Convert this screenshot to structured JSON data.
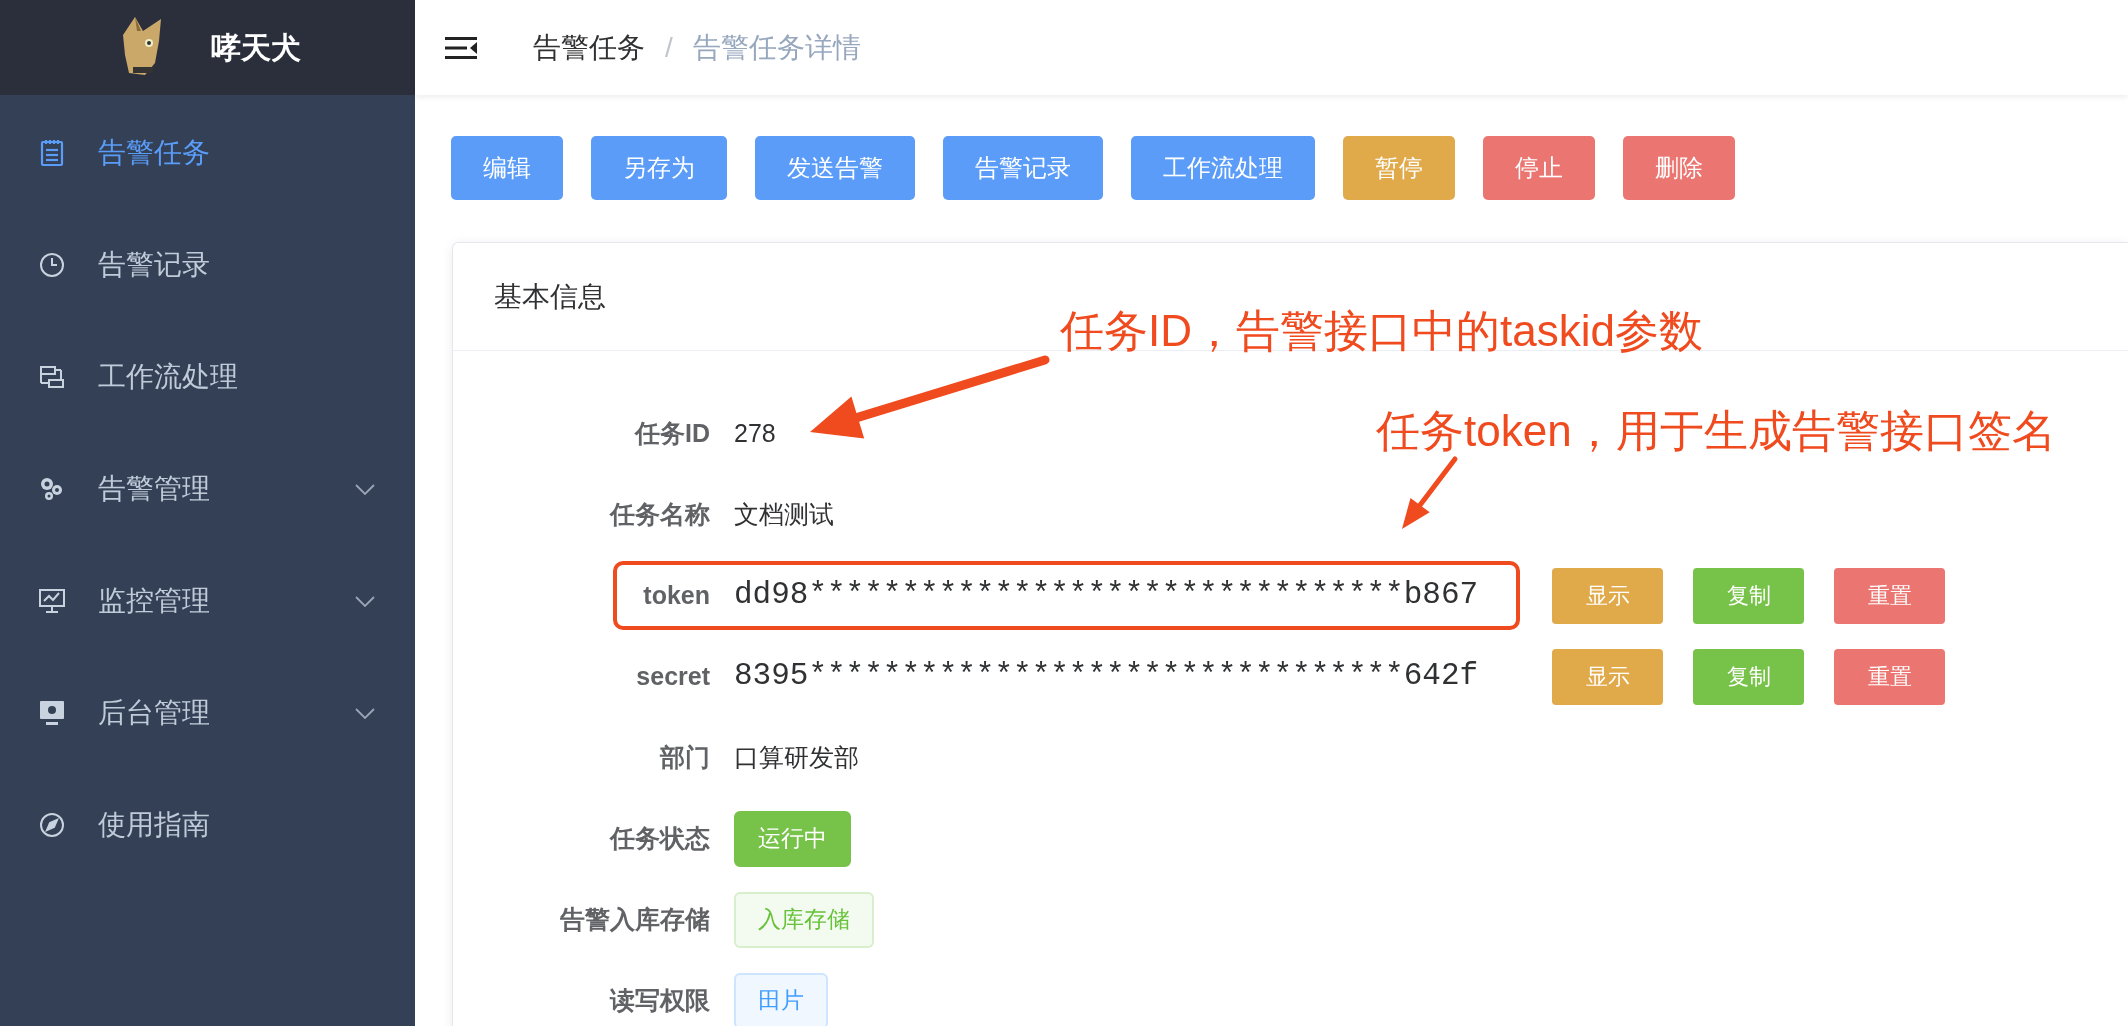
{
  "app": {
    "name": "哮天犬"
  },
  "sidebar": {
    "items": [
      {
        "label": "告警任务",
        "selected": true,
        "expandable": false
      },
      {
        "label": "告警记录",
        "selected": false,
        "expandable": false
      },
      {
        "label": "工作流处理",
        "selected": false,
        "expandable": false
      },
      {
        "label": "告警管理",
        "selected": false,
        "expandable": true
      },
      {
        "label": "监控管理",
        "selected": false,
        "expandable": true
      },
      {
        "label": "后台管理",
        "selected": false,
        "expandable": true
      },
      {
        "label": "使用指南",
        "selected": false,
        "expandable": false
      }
    ]
  },
  "breadcrumb": [
    {
      "label": "告警任务",
      "current": false
    },
    {
      "label": "告警任务详情",
      "current": true
    }
  ],
  "breadcrumb_separator": "/",
  "actions": [
    {
      "label": "编辑",
      "kind": "primary"
    },
    {
      "label": "另存为",
      "kind": "primary"
    },
    {
      "label": "发送告警",
      "kind": "primary"
    },
    {
      "label": "告警记录",
      "kind": "primary"
    },
    {
      "label": "工作流处理",
      "kind": "primary"
    },
    {
      "label": "暂停",
      "kind": "warning"
    },
    {
      "label": "停止",
      "kind": "danger"
    },
    {
      "label": "删除",
      "kind": "danger"
    }
  ],
  "card": {
    "title": "基本信息",
    "fields": [
      {
        "label": "任务ID",
        "kind": "text",
        "value": "278"
      },
      {
        "label": "任务名称",
        "kind": "text",
        "value": "文档测试"
      },
      {
        "label": "token",
        "kind": "secret",
        "value": "dd98********************************b867",
        "highlighted": true,
        "buttons": [
          {
            "label": "显示",
            "kind": "warning"
          },
          {
            "label": "复制",
            "kind": "success"
          },
          {
            "label": "重置",
            "kind": "danger"
          }
        ]
      },
      {
        "label": "secret",
        "kind": "secret",
        "value": "8395********************************642f",
        "highlighted": false,
        "buttons": [
          {
            "label": "显示",
            "kind": "warning"
          },
          {
            "label": "复制",
            "kind": "success"
          },
          {
            "label": "重置",
            "kind": "danger"
          }
        ]
      },
      {
        "label": "部门",
        "kind": "text",
        "value": "口算研发部"
      },
      {
        "label": "任务状态",
        "kind": "tag",
        "value": "运行中",
        "color": "#77c249",
        "filled": true
      },
      {
        "label": "告警入库存储",
        "kind": "tag",
        "value": "入库存储",
        "color": "#67c23a",
        "filled": false
      },
      {
        "label": "读写权限",
        "kind": "tag",
        "value": "田片",
        "color": "#409eff",
        "filled": false
      }
    ]
  },
  "annotations": [
    {
      "text": "任务ID，告警接口中的taskid参数"
    },
    {
      "text": "任务token，用于生成告警接口签名"
    }
  ]
}
